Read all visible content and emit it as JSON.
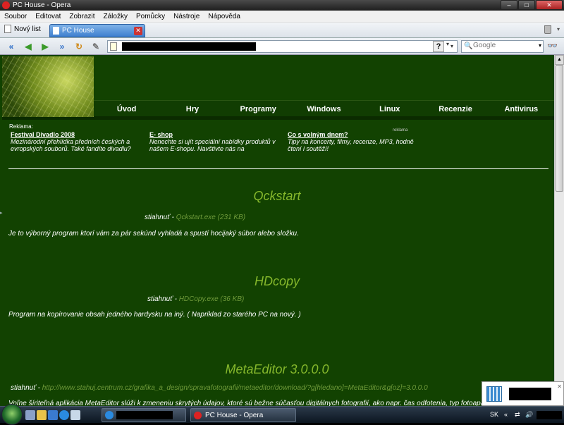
{
  "window": {
    "title": "PC House - Opera"
  },
  "menu": [
    "Soubor",
    "Editovat",
    "Zobrazit",
    "Záložky",
    "Pomůcky",
    "Nástroje",
    "Nápověda"
  ],
  "tabs": {
    "new_tab_label": "Nový list",
    "active_tab_label": "PC House"
  },
  "address": {
    "url": "",
    "help_label": "?"
  },
  "search": {
    "placeholder": "Google"
  },
  "site": {
    "nav": [
      "Úvod",
      "Hry",
      "Programy",
      "Windows",
      "Linux",
      "Recenzie",
      "Antivirus"
    ],
    "ads_label": "Reklama:",
    "ads": [
      {
        "title": "Festival Divadlo 2008",
        "desc": "Mezinárodní přehlídka předních českých a evropských souborů. Také fandíte divadlu?"
      },
      {
        "title": "E- shop",
        "desc": "Nenechte si ujít speciální nabídky produktů v našem E-shopu. Navštivte nás na"
      },
      {
        "title": "Co s volným dnem?",
        "desc": "Tipy na koncerty, filmy, recenze, MP3, hodně čtení i soutěží!"
      }
    ],
    "ad_extra": "reklama",
    "programs": [
      {
        "name": "Qckstart",
        "dl_prefix": "stiahnuť - ",
        "dl_link": "Qckstart.exe (231 KB)",
        "desc": "Je to výborný program ktorí vám za pár sekúnd vyhladá a spustí hocijaký súbor alebo složku."
      },
      {
        "name": "HDcopy",
        "dl_prefix": "stiahnuť - ",
        "dl_link": "HDCopy.exe (36 KB)",
        "desc": "Program na kopírovanie obsah jedného hardysku na iný. ( Napriklad zo starého PC na nový. )"
      },
      {
        "name": "MetaEditor 3.0.0.0",
        "dl_prefix": "stiahnuť - ",
        "dl_link": "http://www.stahuj.centrum.cz/grafika_a_design/spravafotografii/metaeditor/download/?g[hledano]=MetaEditor&g[oz]=3.0.0.0",
        "desc": "Voľne šíriteľná aplikácia MetaEditor slúži k zmeneniu skrytých údajov, ktoré sú bežne súčasťou digitálnych fotografií, ako napr. čas odfotenia, typ fotoaparátu, c"
      }
    ]
  },
  "taskbar": {
    "opera_item": "PC House - Opera",
    "lang": "SK"
  },
  "colors": {
    "page_bg": "#124201",
    "title_green": "#86b82c",
    "link_green": "#6f9a3a",
    "tab_blue": "#3e7fcf"
  }
}
